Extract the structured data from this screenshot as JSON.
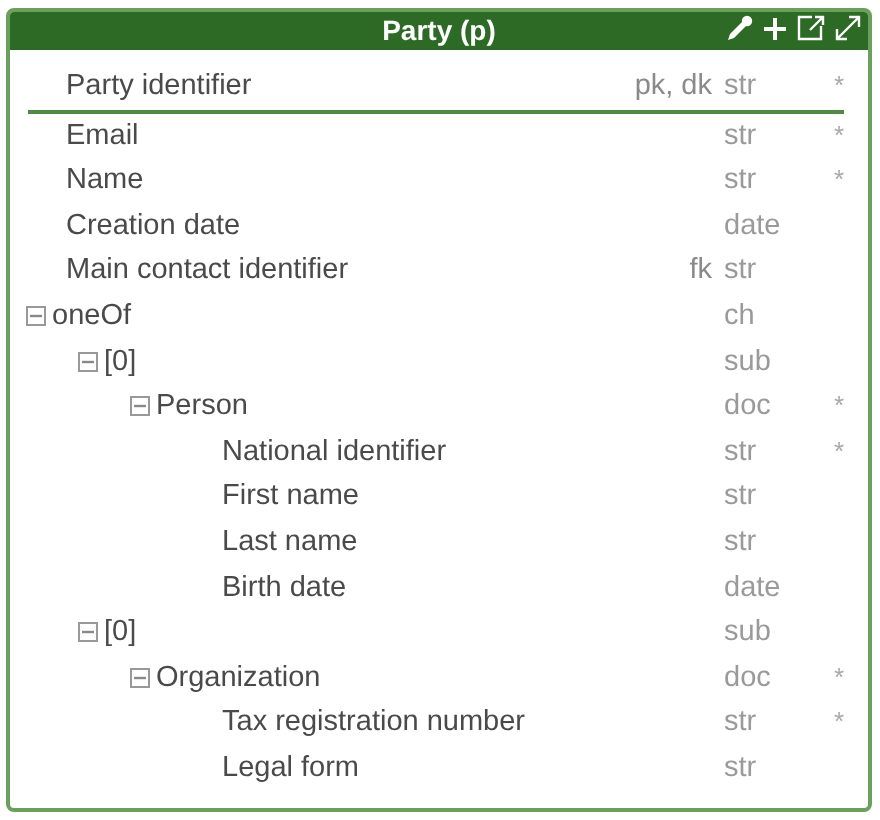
{
  "entity": {
    "title": "Party (p)",
    "primary_fields": [
      {
        "name": "Party identifier",
        "keys": "pk, dk",
        "type": "str",
        "required_mark": "*"
      }
    ],
    "fields": [
      {
        "name": "Email",
        "type": "str",
        "required_mark": "*"
      },
      {
        "name": "Name",
        "type": "str",
        "required_mark": "*"
      },
      {
        "name": "Creation date",
        "type": "date"
      },
      {
        "name": "Main contact identifier",
        "keys": "fk",
        "type": "str"
      },
      {
        "name": "oneOf",
        "type": "ch",
        "expanded": true,
        "children": [
          {
            "name": "[0]",
            "type": "sub",
            "expanded": true,
            "children": [
              {
                "name": "Person",
                "type": "doc",
                "required_mark": "*",
                "expanded": true,
                "children": [
                  {
                    "name": "National identifier",
                    "type": "str",
                    "required_mark": "*"
                  },
                  {
                    "name": "First name",
                    "type": "str"
                  },
                  {
                    "name": "Last name",
                    "type": "str"
                  },
                  {
                    "name": "Birth date",
                    "type": "date"
                  }
                ]
              }
            ]
          },
          {
            "name": "[0]",
            "type": "sub",
            "expanded": true,
            "children": [
              {
                "name": "Organization",
                "type": "doc",
                "required_mark": "*",
                "expanded": true,
                "children": [
                  {
                    "name": "Tax registration number",
                    "type": "str",
                    "required_mark": "*"
                  },
                  {
                    "name": "Legal form",
                    "type": "str"
                  }
                ]
              }
            ]
          }
        ]
      }
    ]
  }
}
